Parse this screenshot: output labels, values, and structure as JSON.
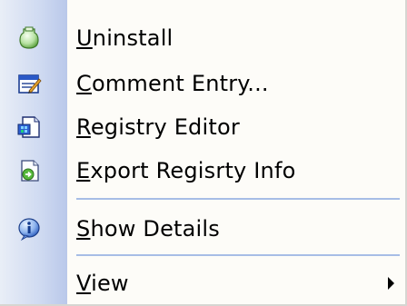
{
  "menu": {
    "items": [
      {
        "label": "Uninstall",
        "mnemonic": "U",
        "icon": "uninstall-icon"
      },
      {
        "label": "Comment Entry...",
        "mnemonic": "C",
        "icon": "comment-icon"
      },
      {
        "label": "Registry Editor",
        "mnemonic": "R",
        "icon": "registry-editor-icon"
      },
      {
        "label": "Export Regisrty Info",
        "mnemonic": "E",
        "icon": "export-icon"
      },
      {
        "label": "Show Details",
        "mnemonic": "S",
        "icon": "info-icon"
      },
      {
        "label": "View",
        "mnemonic": "V",
        "icon": "",
        "submenu": true
      }
    ]
  }
}
